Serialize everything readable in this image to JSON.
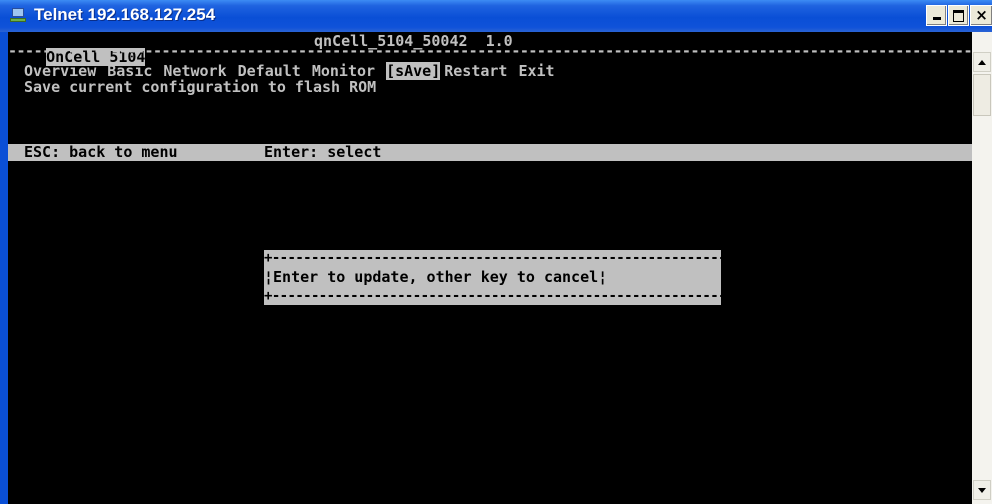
{
  "window": {
    "title": "Telnet 192.168.127.254",
    "minimize_label": "_",
    "maximize_label": "□",
    "close_label": "×"
  },
  "terminal": {
    "device_name": "OnCell 5104",
    "firmware": "qnCell_5104_50042  1.0",
    "menu": [
      {
        "label": "Overview"
      },
      {
        "label": "Basic"
      },
      {
        "label": "Network"
      },
      {
        "label": "Default"
      },
      {
        "label": "Monitor"
      },
      {
        "label": "[sAve]",
        "selected": true
      },
      {
        "label": "Restart"
      },
      {
        "label": "Exit"
      }
    ],
    "description": "Save current configuration to flash ROM",
    "status": {
      "esc": "ESC: back to menu",
      "enter": "Enter: select"
    },
    "dialog": {
      "message": "¦Enter to update, other key to cancel¦"
    }
  }
}
